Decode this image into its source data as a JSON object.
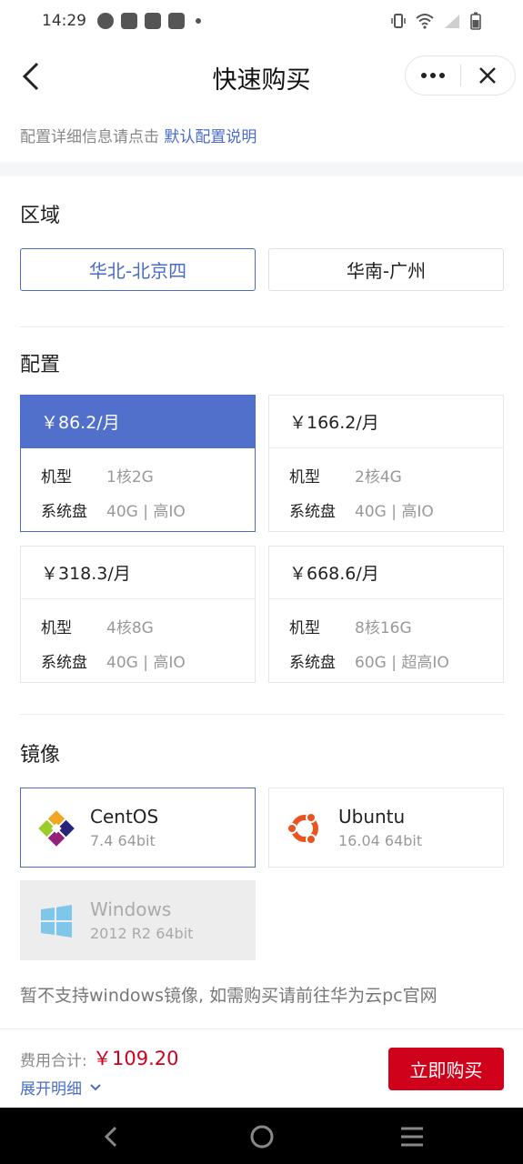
{
  "status_bar": {
    "time": "14:29",
    "left_icons": [
      "dial-icon",
      "mail-icon",
      "mail-icon",
      "mail-icon",
      "dot-icon"
    ],
    "right_icons": [
      "vibrate-icon",
      "wifi-icon",
      "signal-icon",
      "battery-icon"
    ]
  },
  "nav": {
    "title": "快速购买",
    "back_icon": "back-icon",
    "more_icon": "more-icon",
    "close_icon": "close-icon"
  },
  "info": {
    "prefix": "配置详细信息请点击",
    "link": "默认配置说明"
  },
  "region": {
    "title": "区域",
    "options": [
      {
        "label": "华北-北京四",
        "selected": true
      },
      {
        "label": "华南-广州",
        "selected": false
      }
    ]
  },
  "config": {
    "title": "配置",
    "machine_label": "机型",
    "disk_label": "系统盘",
    "plans": [
      {
        "price": "￥86.2/月",
        "machine": "1核2G",
        "disk": "40G | 高IO",
        "selected": true
      },
      {
        "price": "￥166.2/月",
        "machine": "2核4G",
        "disk": "40G | 高IO",
        "selected": false
      },
      {
        "price": "￥318.3/月",
        "machine": "4核8G",
        "disk": "40G | 高IO",
        "selected": false
      },
      {
        "price": "￥668.6/月",
        "machine": "8核16G",
        "disk": "60G | 超高IO",
        "selected": false
      }
    ]
  },
  "image": {
    "title": "镜像",
    "options": [
      {
        "name": "CentOS",
        "version": "7.4 64bit",
        "icon": "centos-logo-icon",
        "selected": true,
        "disabled": false
      },
      {
        "name": "Ubuntu",
        "version": "16.04 64bit",
        "icon": "ubuntu-logo-icon",
        "selected": false,
        "disabled": false
      },
      {
        "name": "Windows",
        "version": "2012 R2 64bit",
        "icon": "windows-logo-icon",
        "selected": false,
        "disabled": true
      }
    ],
    "notice": "暂不支持windows镜像, 如需购买请前往华为云pc官网"
  },
  "footer": {
    "total_label": "费用合计:",
    "total_value": "￥109.20",
    "expand_label": "展开明细",
    "buy_label": "立即购买"
  },
  "colors": {
    "accent": "#4a6cc9",
    "selected_fill": "#5070cc",
    "price_red": "#d0021b"
  }
}
